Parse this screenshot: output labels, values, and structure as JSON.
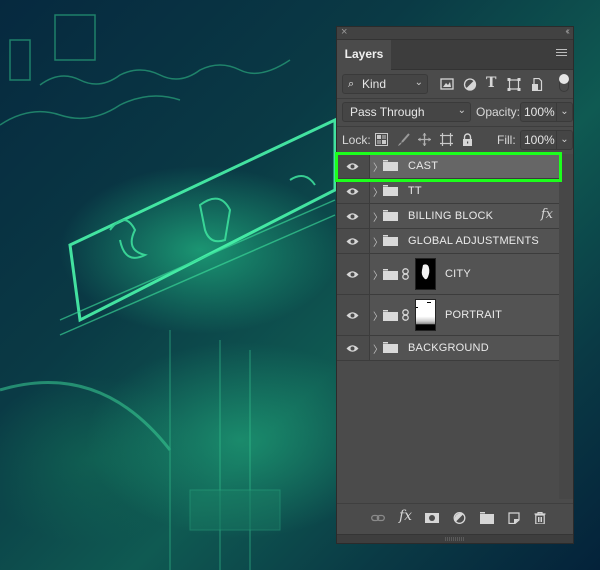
{
  "panel": {
    "close_glyph": "×",
    "collapse_glyph": "‹‹",
    "tab_label": "Layers",
    "menu_icon": "panel-menu-icon",
    "filter": {
      "search_glyph": "⌕",
      "kind_label": "Kind",
      "chevron": "⌄",
      "icons": [
        "pixel-filter-icon",
        "adjustment-filter-icon",
        "type-filter-icon",
        "shape-filter-icon",
        "smart-object-filter-icon"
      ],
      "type_glyph": "T",
      "toggle": "filter-toggle"
    },
    "blend": {
      "mode": "Pass Through",
      "chevron": "⌄",
      "opacity_label": "Opacity:",
      "opacity_value": "100%"
    },
    "lock": {
      "label": "Lock:",
      "icons": [
        "lock-transparent-icon",
        "lock-image-icon",
        "lock-position-icon",
        "lock-artboard-icon",
        "lock-all-icon"
      ],
      "fill_label": "Fill:",
      "fill_value": "100%"
    },
    "layers": [
      {
        "name": "CAST",
        "type": "group",
        "visible": true,
        "selected": true
      },
      {
        "name": "TT",
        "type": "group",
        "visible": true
      },
      {
        "name": "BILLING BLOCK",
        "type": "group",
        "visible": true,
        "fx": "fx",
        "fx_toggle": "⌄"
      },
      {
        "name": "GLOBAL ADJUSTMENTS",
        "type": "group",
        "visible": true
      },
      {
        "name": "CITY",
        "type": "group",
        "visible": true,
        "mask": "dark-mask",
        "linked": true
      },
      {
        "name": "PORTRAIT",
        "type": "group",
        "visible": true,
        "mask": "light-mask",
        "linked": true
      },
      {
        "name": "BACKGROUND",
        "type": "group",
        "visible": true
      }
    ],
    "bottom_icons": [
      "link-layers-icon",
      "add-style-icon",
      "add-mask-icon",
      "new-adjustment-icon",
      "new-group-icon",
      "new-layer-icon",
      "delete-layer-icon"
    ],
    "fx_glyph": "fx",
    "highlight_color": "#1cff1c"
  }
}
